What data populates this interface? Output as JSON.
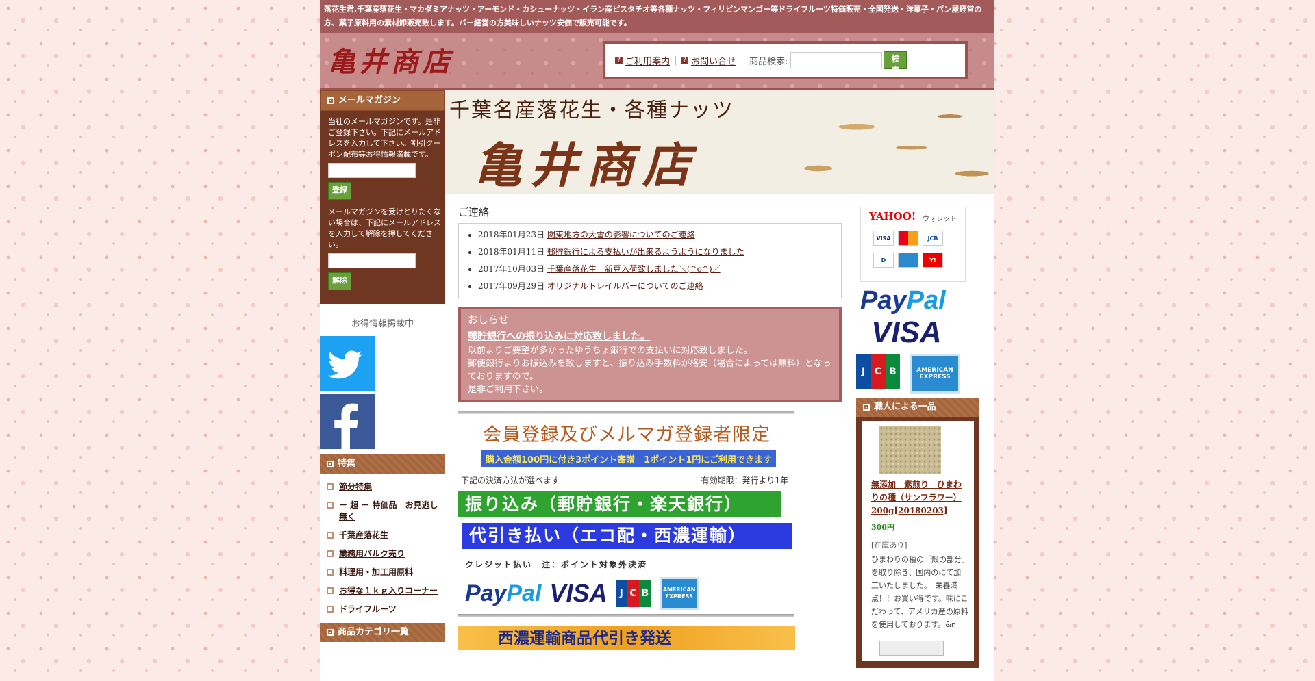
{
  "topbar": {
    "text": "落花生君,千葉産落花生・マカダミアナッツ・アーモンド・カシューナッツ・イラン産ピスタチオ等各種ナッツ・フィリピンマンゴー等ドライフルーツ特価販売・全国発送・洋菓子・パン屋経営の方、菓子原料用の素材卸販売致します。バー経営の方美味しいナッツ安価で販売可能です。"
  },
  "header": {
    "logo": "亀井商店",
    "guide_link": "ご利用案内",
    "contact_link": "お問い合せ",
    "search_label": "商品検索:",
    "search_placeholder": "",
    "search_button": "検索"
  },
  "banner": {
    "subtitle": "千葉名産落花生・各種ナッツ",
    "title": "亀井商店"
  },
  "mailmag": {
    "title": "メールマガジン",
    "intro": "当社のメールマガジンです。是非ご登録下さい。下記にメールアドレスを入力して下さい。割引クーポン配布等お得情報満載です。",
    "register_button": "登録",
    "unsubscribe_text": "メールマガジンを受けとりたくない場合は、下記にメールアドレスを入力して解除を押してください。",
    "unsubscribe_button": "解除"
  },
  "deals_label": "お得情報掲載中",
  "feature": {
    "title": "特集",
    "items": [
      "節分特集",
      "－ 超 － 特価品　お見逃し無く",
      "千葉産落花生",
      "業務用バルク売り",
      "料理用・加工用原料",
      "お得な１ｋｇ入りコーナー",
      "ドライフルーツ"
    ]
  },
  "category_title": "商品カテゴリ一覧",
  "contact": {
    "title": "ご連絡",
    "items": [
      {
        "date": "2018年01月23日",
        "text": "関東地方の大雪の影響についてのご連絡"
      },
      {
        "date": "2018年01月11日",
        "text": "郵貯銀行による支払いが出来るようようになりました"
      },
      {
        "date": "2017年10月03日",
        "text": "千葉産落花生　新豆入荷致しました＼(^o^)／"
      },
      {
        "date": "2017年09月29日",
        "text": "オリジナルトレイルバーについてのご連絡"
      }
    ]
  },
  "notice": {
    "title": "おしらせ",
    "link": "郵貯銀行への振り込みに対応致しました。",
    "lines": [
      "以前よりご要望が多かったゆうちょ銀行での支払いに対応致しました。",
      "郵便銀行よりお振込みを致しますと、振り込み手数料が格安（場合によっては無料）となっておりますので。",
      "是非ご利用下さい。"
    ]
  },
  "promo": {
    "title": "会員登録及びメルマガ登録者限定",
    "sub": "購入金額100円に付き3ポイント寄贈　1ポイント1円にご利用できます",
    "methods_label": "下記の決済方法が選べます",
    "validity": "有効期限：発行より1年",
    "bank": "振り込み（郵貯銀行・楽天銀行）",
    "cod": "代引き払い（エコ配・西濃運輸）",
    "credit": "クレジット払い　注：ポイント対象外決済",
    "seino": "西濃運輸商品代引き発送"
  },
  "cards": {
    "paypal_a": "Pay",
    "paypal_b": "Pal",
    "visa": "VISA",
    "jcb": [
      "J",
      "C",
      "B"
    ],
    "amex": "AMERICAN EXPRESS",
    "yahoo": "YAHOO!",
    "yahoo_wallet": "ウォレット"
  },
  "craft": {
    "title": "職人による一品",
    "name": "無添加　素煎り　ひまわりの種（サンフラワー）200g[20180203]",
    "price": "300円",
    "stock": "[在庫あり]",
    "desc": "ひまわりの種の「殻の部分」を取り除き、国内のにて加工いたしました。　栄養満点！！お買い得です。味にこだわって、アメリカ産の原料を使用しております。&n"
  },
  "colors": {
    "topbar": "#a35a5a",
    "header": "#c88b8b",
    "section_head": "#a5643a",
    "mail_box": "#6f3621",
    "notice": "#cd9393",
    "button_green": "#6aa03c"
  }
}
